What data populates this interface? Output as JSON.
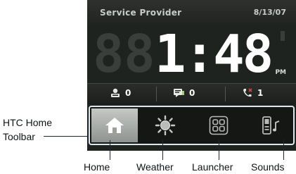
{
  "header": {
    "provider": "Service Provider",
    "date": "8/13/07"
  },
  "clock": {
    "time": "1:48",
    "ampm": "PM"
  },
  "status": {
    "items": [
      {
        "icon": "voicemail-icon",
        "count": "0"
      },
      {
        "icon": "message-icon",
        "count": "0"
      },
      {
        "icon": "missed-call-icon",
        "count": "1"
      }
    ]
  },
  "toolbar": {
    "label_line1": "HTC Home",
    "label_line2": "Toolbar",
    "tools": [
      {
        "name": "Home",
        "icon": "home-icon",
        "active": true
      },
      {
        "name": "Weather",
        "icon": "sun-icon",
        "active": false
      },
      {
        "name": "Launcher",
        "icon": "launcher-grid-icon",
        "active": false
      },
      {
        "name": "Sounds",
        "icon": "phone-sound-icon",
        "active": false
      }
    ]
  },
  "colors": {
    "callout": "#1f2730",
    "toolbar_border": "#dfe6ee",
    "active_tab": "#c5c8c5"
  }
}
